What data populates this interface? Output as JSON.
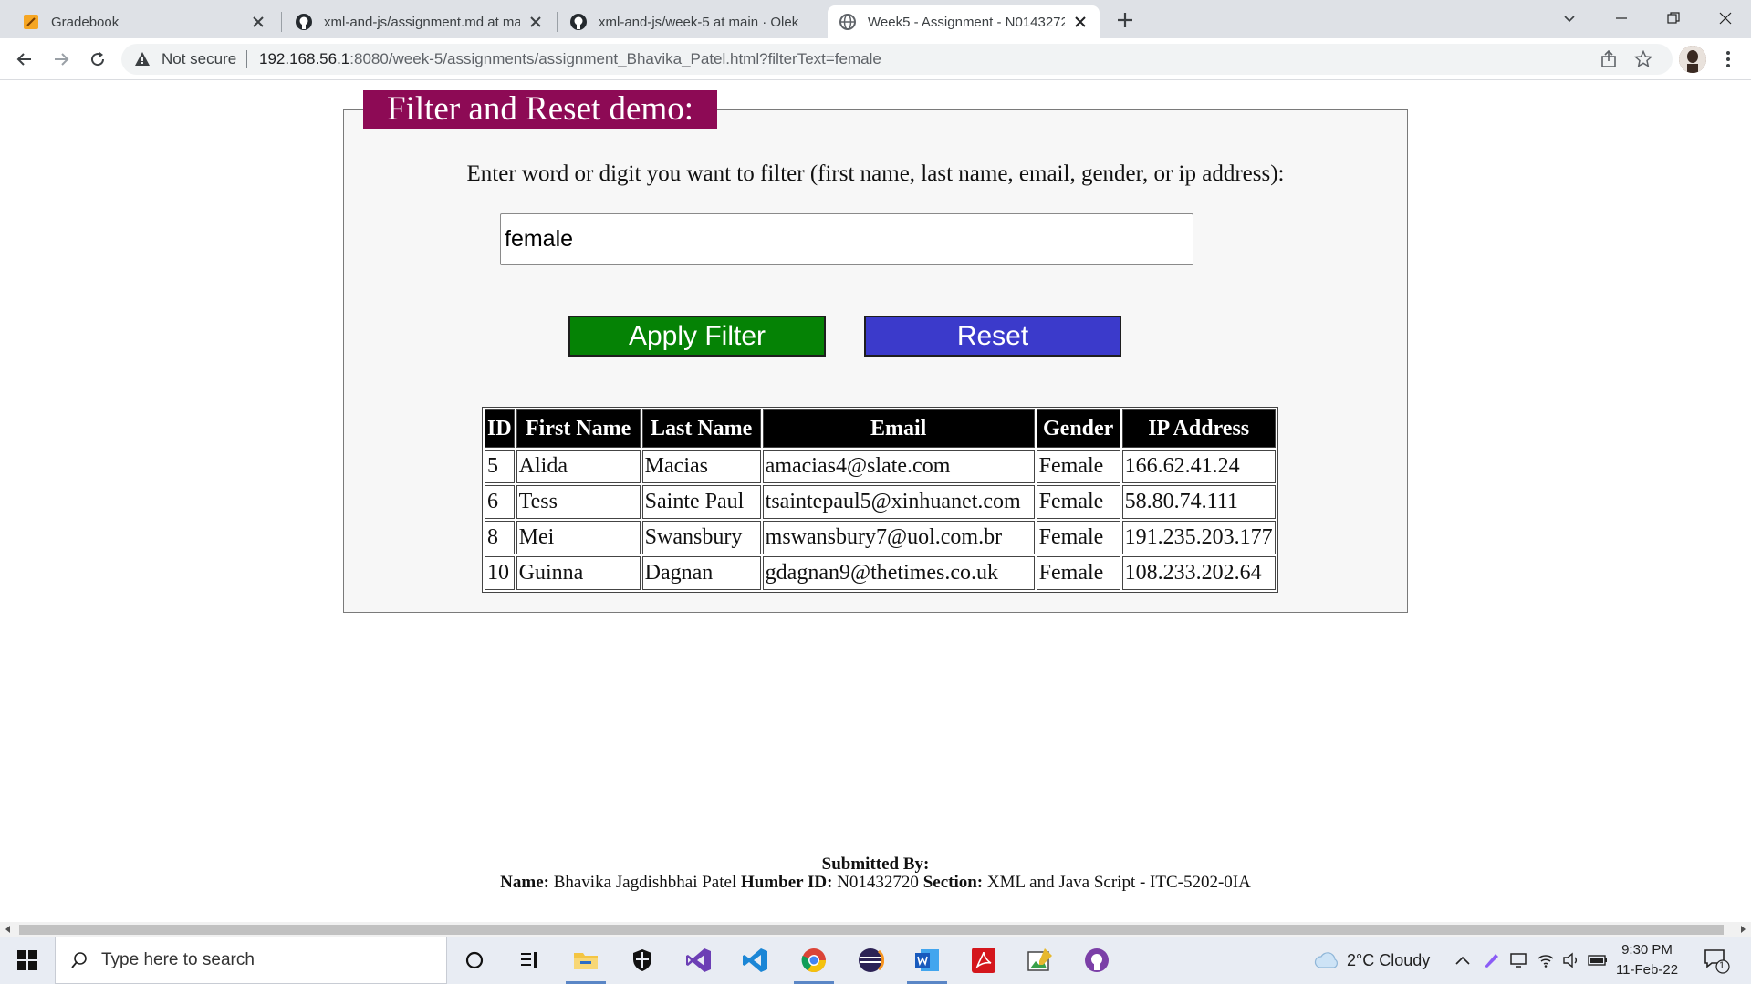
{
  "browser": {
    "tabs": [
      {
        "title": "Gradebook",
        "favicon": "gradebook-icon",
        "active": false
      },
      {
        "title": "xml-and-js/assignment.md at ma",
        "favicon": "github-icon",
        "active": false
      },
      {
        "title": "xml-and-js/week-5 at main · Olek",
        "favicon": "github-icon",
        "active": false
      },
      {
        "title": "Week5 - Assignment - N0143272",
        "favicon": "globe-icon",
        "active": true
      }
    ],
    "security_label": "Not secure",
    "url_host": "192.168.56.1",
    "url_path": ":8080/week-5/assignments/assignment_Bhavika_Patel.html?filterText=female"
  },
  "page": {
    "legend": "Filter and Reset demo:",
    "prompt": "Enter word or digit you want to filter (first name, last name, email, gender, or ip address):",
    "filter_value": "female",
    "apply_label": "Apply Filter",
    "reset_label": "Reset",
    "table": {
      "headers": [
        "ID",
        "First Name",
        "Last Name",
        "Email",
        "Gender",
        "IP Address"
      ],
      "rows": [
        [
          "5",
          "Alida",
          "Macias",
          "amacias4@slate.com",
          "Female",
          "166.62.41.24"
        ],
        [
          "6",
          "Tess",
          "Sainte Paul",
          "tsaintepaul5@xinhuanet.com",
          "Female",
          "58.80.74.111"
        ],
        [
          "8",
          "Mei",
          "Swansbury",
          "mswansbury7@uol.com.br",
          "Female",
          "191.235.203.177"
        ],
        [
          "10",
          "Guinna",
          "Dagnan",
          "gdagnan9@thetimes.co.uk",
          "Female",
          "108.233.202.64"
        ]
      ]
    },
    "footer": {
      "submitted_by": "Submitted By:",
      "name_label": "Name:",
      "name_value": "Bhavika Jagdishbhai Patel",
      "id_label": "Humber ID:",
      "id_value": "N01432720",
      "section_label": "Section:",
      "section_value": "XML and Java Script - ITC-5202-0IA"
    }
  },
  "taskbar": {
    "search_placeholder": "Type here to search",
    "apps": [
      "task-view-icon",
      "widgets-icon",
      "file-explorer-icon",
      "security-shield-icon",
      "visual-studio-icon",
      "vscode-icon",
      "chrome-icon",
      "eclipse-icon",
      "word-icon",
      "acrobat-icon",
      "image-editor-icon",
      "github-desktop-icon"
    ],
    "weather": "2°C  Cloudy",
    "time": "9:30 PM",
    "date": "11-Feb-22",
    "notification_count": "1"
  },
  "colors": {
    "legend_bg": "#8d0a55",
    "apply_bg": "#058205",
    "reset_bg": "#3b3acb",
    "header_bg": "#000000"
  }
}
